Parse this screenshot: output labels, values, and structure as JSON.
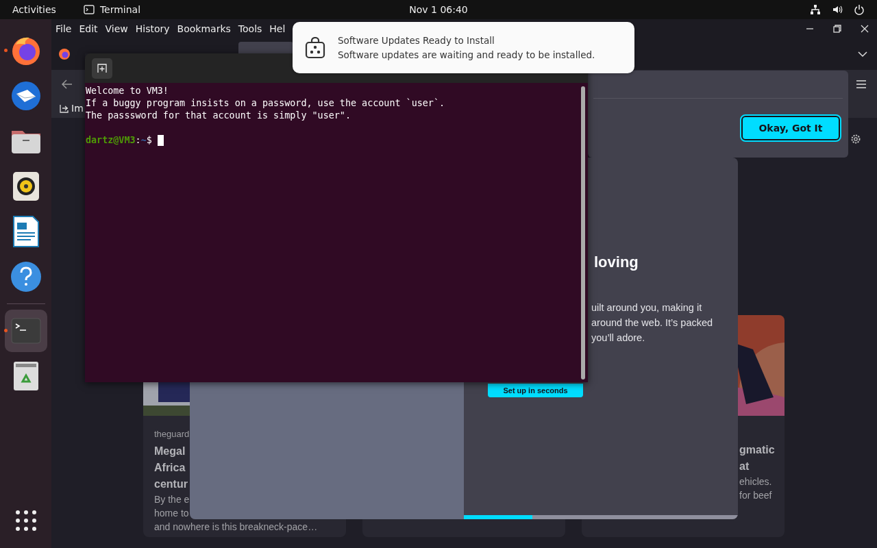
{
  "top_bar": {
    "activities": "Activities",
    "app": "Terminal",
    "clock": "Nov 1  06:40"
  },
  "dock": {
    "favorites": [
      {
        "kind": "browser",
        "running": true,
        "selected": false
      },
      {
        "kind": "mail",
        "running": false,
        "selected": false
      },
      {
        "kind": "files",
        "running": false,
        "selected": false
      },
      {
        "kind": "music",
        "running": false,
        "selected": false
      },
      {
        "kind": "writer",
        "running": false,
        "selected": false
      },
      {
        "kind": "help",
        "running": false,
        "selected": false
      }
    ],
    "others": [
      {
        "kind": "terminal",
        "running": true,
        "selected": true
      },
      {
        "kind": "trash",
        "running": false,
        "selected": false
      }
    ]
  },
  "browser": {
    "menu": [
      "File",
      "Edit",
      "View",
      "History",
      "Bookmarks",
      "Tools",
      "Hel"
    ],
    "bookmarks": [
      {
        "label": "Im"
      }
    ],
    "panel": {
      "button": "Okay, Got It"
    },
    "modal": {
      "heading": "loving",
      "paragraph": [
        "uilt around you, making it",
        "around the web. It’s packed",
        "you’ll adore."
      ],
      "cta": "Set up in seconds",
      "progress": {
        "level": 0.25
      }
    },
    "cards": [
      {
        "kind": "article",
        "source": "theguard",
        "title": [
          "Megal",
          "Africa",
          "centur"
        ],
        "text": [
          "By the e",
          "home to",
          "and nowhere is this breakneck-pace…"
        ]
      },
      {
        "kind": "blank"
      },
      {
        "kind": "article",
        "title": [
          "gmatic",
          "at"
        ],
        "text": [
          "ehicles.",
          "for beef"
        ]
      }
    ]
  },
  "terminal": {
    "lines": [
      "Welcome to VM3!",
      "If a buggy program insists on a password, use the account `user`.",
      "The passsword for that account is simply \"user\"."
    ],
    "prompt": {
      "user": "dartz@VM3",
      "sep": ":",
      "dir": "~",
      "symbol": "$ "
    }
  },
  "notification": {
    "title": "Software Updates Ready to Install",
    "body": "Software updates are waiting and ready to be installed."
  }
}
